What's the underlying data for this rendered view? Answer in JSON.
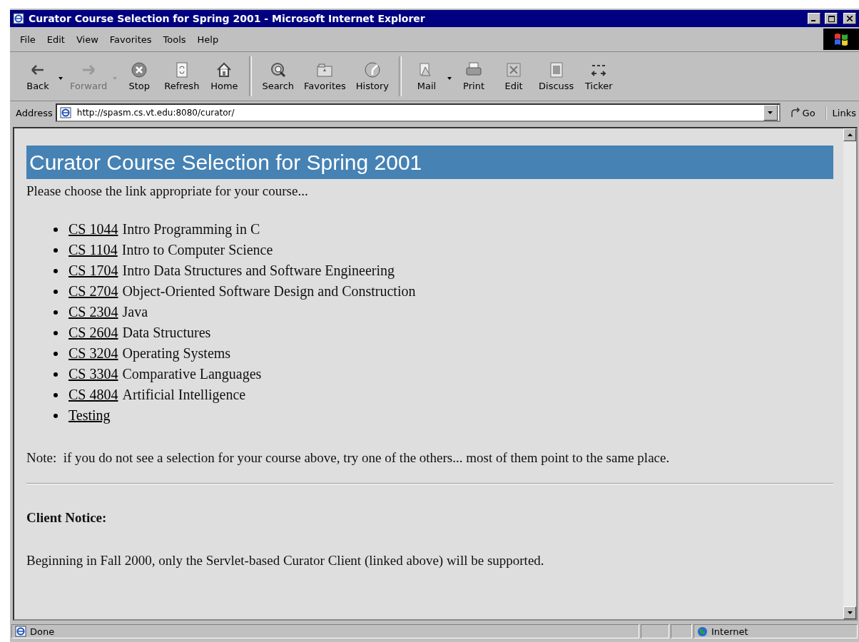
{
  "window": {
    "title": "Curator Course Selection for Spring 2001 - Microsoft Internet Explorer"
  },
  "menu": [
    {
      "label": "File"
    },
    {
      "label": "Edit"
    },
    {
      "label": "View"
    },
    {
      "label": "Favorites"
    },
    {
      "label": "Tools"
    },
    {
      "label": "Help"
    }
  ],
  "toolbar": [
    {
      "kind": "back",
      "label": "Back",
      "disabled": false,
      "dropdown": true
    },
    {
      "kind": "forward",
      "label": "Forward",
      "disabled": true,
      "dropdown": true
    },
    {
      "kind": "stop",
      "label": "Stop",
      "disabled": false,
      "dropdown": false
    },
    {
      "kind": "refresh",
      "label": "Refresh",
      "disabled": false,
      "dropdown": false
    },
    {
      "kind": "home",
      "label": "Home",
      "disabled": false,
      "dropdown": false
    },
    {
      "kind": "sep"
    },
    {
      "kind": "search",
      "label": "Search",
      "disabled": false,
      "dropdown": false
    },
    {
      "kind": "favorites",
      "label": "Favorites",
      "disabled": false,
      "dropdown": false
    },
    {
      "kind": "history",
      "label": "History",
      "disabled": false,
      "dropdown": false
    },
    {
      "kind": "sep"
    },
    {
      "kind": "mail",
      "label": "Mail",
      "disabled": false,
      "dropdown": true
    },
    {
      "kind": "print",
      "label": "Print",
      "disabled": false,
      "dropdown": false
    },
    {
      "kind": "edit",
      "label": "Edit",
      "disabled": false,
      "dropdown": false
    },
    {
      "kind": "discuss",
      "label": "Discuss",
      "disabled": false,
      "dropdown": false
    },
    {
      "kind": "ticker",
      "label": "Ticker",
      "disabled": false,
      "dropdown": false
    }
  ],
  "address": {
    "label": "Address",
    "value": "http://spasm.cs.vt.edu:8080/curator/",
    "go": "Go",
    "links": "Links"
  },
  "page": {
    "heading": "Curator Course Selection for Spring 2001",
    "intro": "Please choose the link appropriate for your course...",
    "courses": [
      {
        "code": "CS 1044",
        "title": "Intro Programming in C"
      },
      {
        "code": "CS 1104",
        "title": "Intro to Computer Science"
      },
      {
        "code": "CS 1704",
        "title": "Intro Data Structures and Software Engineering"
      },
      {
        "code": "CS 2704",
        "title": "Object-Oriented Software Design and Construction"
      },
      {
        "code": "CS 2304",
        "title": "Java"
      },
      {
        "code": "CS 2604",
        "title": "Data Structures"
      },
      {
        "code": "CS 3204",
        "title": "Operating Systems"
      },
      {
        "code": "CS 3304",
        "title": "Comparative Languages"
      },
      {
        "code": "CS 4804",
        "title": "Artificial Intelligence"
      },
      {
        "code": "Testing"
      }
    ],
    "note": "Note:  if you do not see a selection for your course above, try one of the others... most of them point to the same place.",
    "notice_heading": "Client Notice:",
    "notice_text": "Beginning in Fall 2000, only the Servlet-based Curator Client (linked above) will be supported."
  },
  "status_bar": {
    "text": "Done",
    "zone": "Internet"
  }
}
